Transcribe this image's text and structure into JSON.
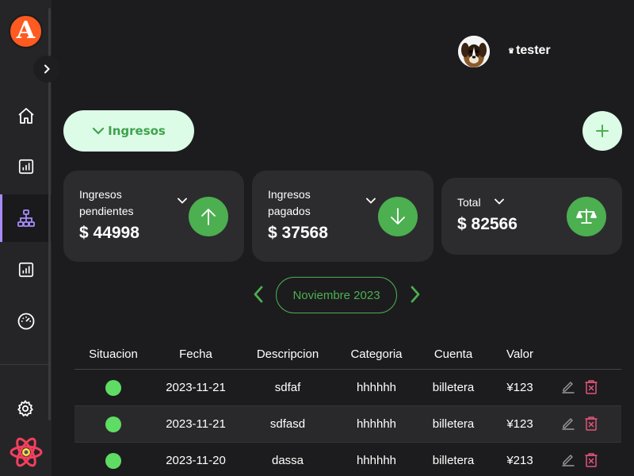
{
  "app": {
    "logo_letter": "A"
  },
  "sidebar": {
    "items": [
      {
        "name": "home",
        "icon": "home-icon",
        "active": false
      },
      {
        "name": "reports",
        "icon": "bar-chart-icon",
        "active": false
      },
      {
        "name": "hierarchy",
        "icon": "sitemap-icon",
        "active": true
      },
      {
        "name": "stats",
        "icon": "bar-chart-icon",
        "active": false
      },
      {
        "name": "dashboard",
        "icon": "speedometer-icon",
        "active": false
      }
    ],
    "accent_color": "#a78bfa"
  },
  "header": {
    "username": "tester",
    "crown_icon": "♛"
  },
  "toolbar": {
    "tipo_label": "Ingresos",
    "add_label": "+"
  },
  "cards": {
    "pendientes": {
      "label_line1": "Ingresos",
      "label_line2": "pendientes",
      "value": "$ 44998"
    },
    "pagados": {
      "label_line1": "Ingresos",
      "label_line2": "pagados",
      "value": "$ 37568"
    },
    "total": {
      "label": "Total",
      "value": "$ 82566"
    }
  },
  "month": {
    "label": "Noviembre 2023"
  },
  "table": {
    "headers": [
      "Situacion",
      "Fecha",
      "Descripcion",
      "Categoria",
      "Cuenta",
      "Valor"
    ],
    "rows": [
      {
        "fecha": "2023-11-21",
        "descripcion": "sdfaf",
        "categoria": "hhhhhh",
        "cuenta": "billetera",
        "valor": "¥123"
      },
      {
        "fecha": "2023-11-21",
        "descripcion": "sdfasd",
        "categoria": "hhhhhh",
        "cuenta": "billetera",
        "valor": "¥123"
      },
      {
        "fecha": "2023-11-20",
        "descripcion": "dassa",
        "categoria": "hhhhhh",
        "cuenta": "billetera",
        "valor": "¥213"
      }
    ]
  },
  "colors": {
    "green": "#4caf50",
    "light_green": "#dcfce7",
    "status_green": "#5fdc63",
    "delete_red": "#e0557a",
    "background": "#1c1c1e",
    "card": "#2c2c2e"
  }
}
